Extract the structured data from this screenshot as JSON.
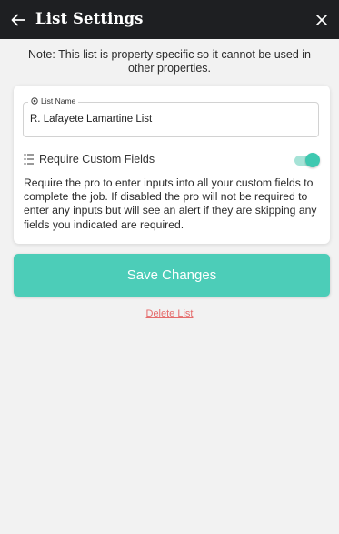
{
  "header": {
    "title": "List Settings",
    "back_icon": "arrow-left-icon",
    "close_icon": "close-icon",
    "background": "#1e1f22"
  },
  "note": "Note: This list is property specific so it cannot be used in other properties.",
  "list_name": {
    "label": "List Name",
    "value": "R. Lafayete Lamartine List"
  },
  "custom_fields": {
    "label": "Require Custom Fields",
    "enabled": true,
    "icon": "list-icon",
    "description": "Require the pro to enter inputs into all your custom fields to complete the job. If disabled the pro will not be required to enter any inputs but will see an alert if they are skipping any fields you indicated are required."
  },
  "actions": {
    "save_label": "Save Changes",
    "delete_label": "Delete List"
  },
  "colors": {
    "accent": "#4ccdb8",
    "danger": "#e56b6b"
  }
}
